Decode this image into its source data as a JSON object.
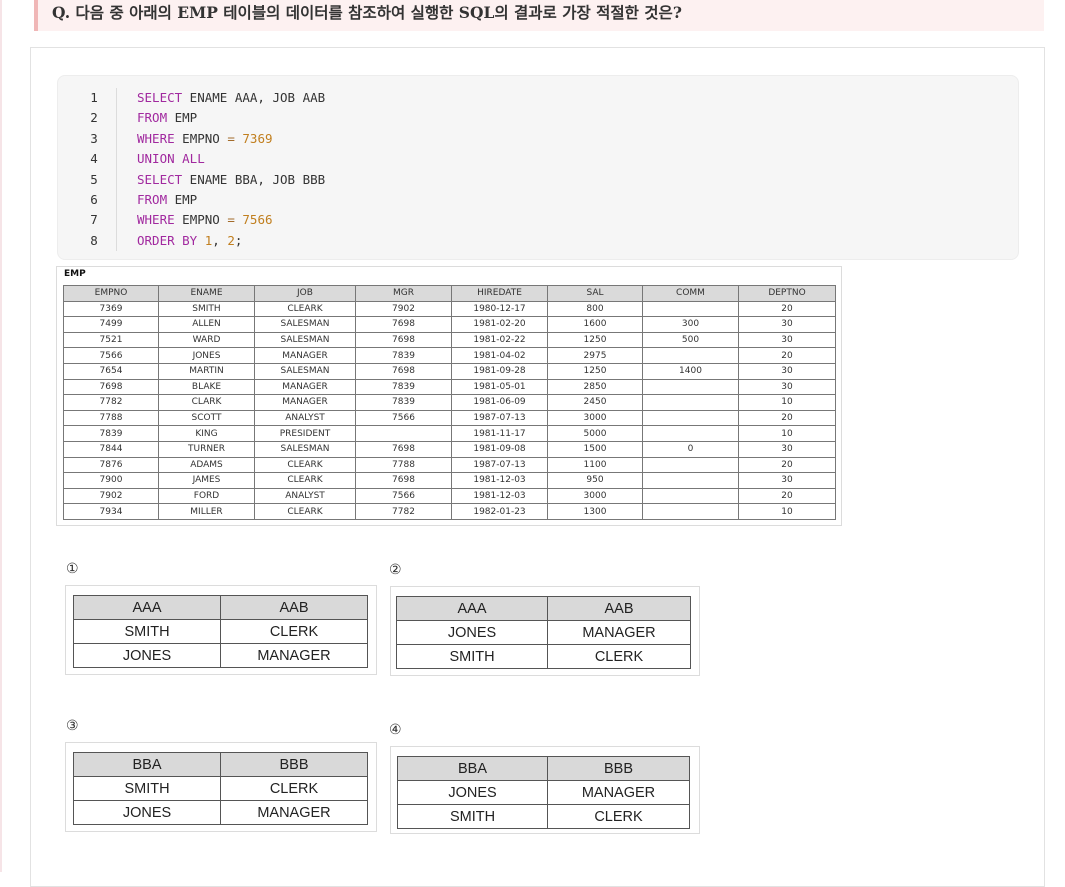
{
  "question": "Q. 다음 중 아래의 EMP 테이블의 데이터를 참조하여 실행한 SQL의 결과로 가장 적절한 것은?",
  "code": {
    "lines": [
      {
        "n": "1",
        "tokens": [
          {
            "t": "SELECT",
            "k": "kw"
          },
          {
            "t": " ENAME AAA, JOB AAB",
            "k": ""
          }
        ]
      },
      {
        "n": "2",
        "tokens": [
          {
            "t": "FROM",
            "k": "kw"
          },
          {
            "t": " EMP",
            "k": ""
          }
        ]
      },
      {
        "n": "3",
        "tokens": [
          {
            "t": "WHERE",
            "k": "kw"
          },
          {
            "t": " EMPNO ",
            "k": ""
          },
          {
            "t": "=",
            "k": "op"
          },
          {
            "t": " ",
            "k": ""
          },
          {
            "t": "7369",
            "k": "num"
          }
        ]
      },
      {
        "n": "4",
        "tokens": [
          {
            "t": "UNION ALL",
            "k": "kw"
          }
        ]
      },
      {
        "n": "5",
        "tokens": [
          {
            "t": "SELECT",
            "k": "kw"
          },
          {
            "t": " ENAME BBA, JOB BBB",
            "k": ""
          }
        ]
      },
      {
        "n": "6",
        "tokens": [
          {
            "t": "FROM",
            "k": "kw"
          },
          {
            "t": " EMP",
            "k": ""
          }
        ]
      },
      {
        "n": "7",
        "tokens": [
          {
            "t": "WHERE",
            "k": "kw"
          },
          {
            "t": " EMPNO ",
            "k": ""
          },
          {
            "t": "=",
            "k": "op"
          },
          {
            "t": " ",
            "k": ""
          },
          {
            "t": "7566",
            "k": "num"
          }
        ]
      },
      {
        "n": "8",
        "tokens": [
          {
            "t": "ORDER BY",
            "k": "kw"
          },
          {
            "t": " ",
            "k": ""
          },
          {
            "t": "1",
            "k": "num"
          },
          {
            "t": ", ",
            "k": ""
          },
          {
            "t": "2",
            "k": "num"
          },
          {
            "t": ";",
            "k": ""
          }
        ]
      }
    ]
  },
  "emp_table": {
    "title": "EMP",
    "headers": [
      "EMPNO",
      "ENAME",
      "JOB",
      "MGR",
      "HIREDATE",
      "SAL",
      "COMM",
      "DEPTNO"
    ],
    "rows": [
      [
        "7369",
        "SMITH",
        "CLEARK",
        "7902",
        "1980-12-17",
        "800",
        "",
        "20"
      ],
      [
        "7499",
        "ALLEN",
        "SALESMAN",
        "7698",
        "1981-02-20",
        "1600",
        "300",
        "30"
      ],
      [
        "7521",
        "WARD",
        "SALESMAN",
        "7698",
        "1981-02-22",
        "1250",
        "500",
        "30"
      ],
      [
        "7566",
        "JONES",
        "MANAGER",
        "7839",
        "1981-04-02",
        "2975",
        "",
        "20"
      ],
      [
        "7654",
        "MARTIN",
        "SALESMAN",
        "7698",
        "1981-09-28",
        "1250",
        "1400",
        "30"
      ],
      [
        "7698",
        "BLAKE",
        "MANAGER",
        "7839",
        "1981-05-01",
        "2850",
        "",
        "30"
      ],
      [
        "7782",
        "CLARK",
        "MANAGER",
        "7839",
        "1981-06-09",
        "2450",
        "",
        "10"
      ],
      [
        "7788",
        "SCOTT",
        "ANALYST",
        "7566",
        "1987-07-13",
        "3000",
        "",
        "20"
      ],
      [
        "7839",
        "KING",
        "PRESIDENT",
        "",
        "1981-11-17",
        "5000",
        "",
        "10"
      ],
      [
        "7844",
        "TURNER",
        "SALESMAN",
        "7698",
        "1981-09-08",
        "1500",
        "0",
        "30"
      ],
      [
        "7876",
        "ADAMS",
        "CLEARK",
        "7788",
        "1987-07-13",
        "1100",
        "",
        "20"
      ],
      [
        "7900",
        "JAMES",
        "CLEARK",
        "7698",
        "1981-12-03",
        "950",
        "",
        "30"
      ],
      [
        "7902",
        "FORD",
        "ANALYST",
        "7566",
        "1981-12-03",
        "3000",
        "",
        "20"
      ],
      [
        "7934",
        "MILLER",
        "CLEARK",
        "7782",
        "1982-01-23",
        "1300",
        "",
        "10"
      ]
    ]
  },
  "options": [
    {
      "number": "①",
      "headers": [
        "AAA",
        "AAB"
      ],
      "rows": [
        [
          "SMITH",
          "CLERK"
        ],
        [
          "JONES",
          "MANAGER"
        ]
      ]
    },
    {
      "number": "②",
      "headers": [
        "AAA",
        "AAB"
      ],
      "rows": [
        [
          "JONES",
          "MANAGER"
        ],
        [
          "SMITH",
          "CLERK"
        ]
      ]
    },
    {
      "number": "③",
      "headers": [
        "BBA",
        "BBB"
      ],
      "rows": [
        [
          "SMITH",
          "CLERK"
        ],
        [
          "JONES",
          "MANAGER"
        ]
      ]
    },
    {
      "number": "④",
      "headers": [
        "BBA",
        "BBB"
      ],
      "rows": [
        [
          "JONES",
          "MANAGER"
        ],
        [
          "SMITH",
          "CLERK"
        ]
      ]
    }
  ]
}
